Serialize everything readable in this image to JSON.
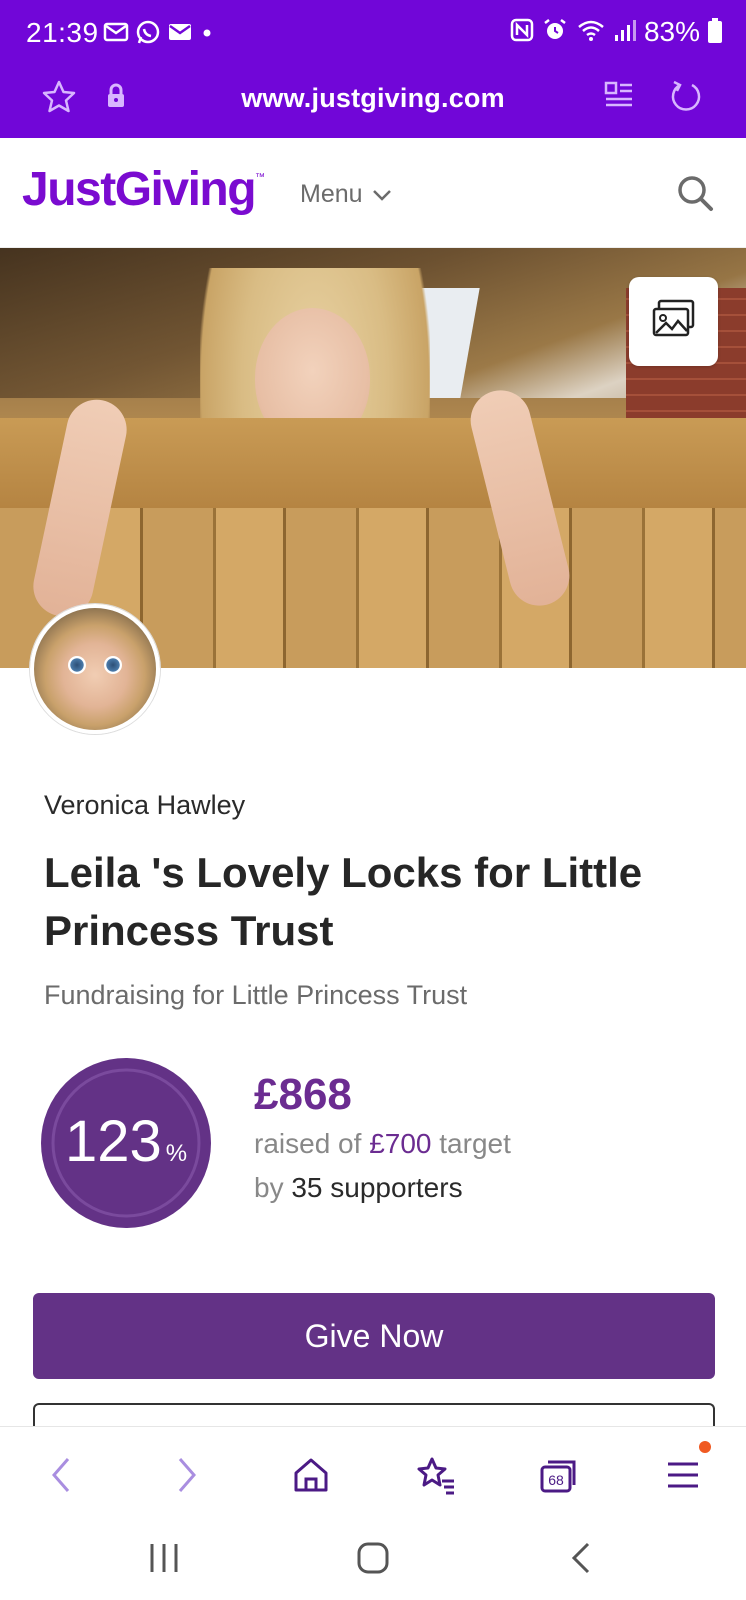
{
  "status_bar": {
    "time": "21:39",
    "battery": "83%"
  },
  "url_bar": {
    "url": "www.justgiving.com"
  },
  "header": {
    "logo": "JustGiving",
    "logo_tm": "™",
    "menu_label": "Menu"
  },
  "fundraiser": {
    "owner": "Veronica Hawley",
    "title": "Leila 's Lovely Locks for Little Princess Trust",
    "subtitle": "Fundraising for Little Princess Trust",
    "progress_percent": "123",
    "progress_symbol": "%",
    "raised": "£868",
    "raised_prefix": "raised of",
    "target": "£700",
    "target_suffix": "target",
    "supporters_prefix": "by",
    "supporters": "35 supporters",
    "give_label": "Give Now"
  },
  "toolbar": {
    "tabs_count": "68"
  },
  "colors": {
    "chrome": "#7106d8",
    "brand": "#7a0bd0",
    "primary": "#633286",
    "accent_text": "#6b2c91",
    "notification": "#f05a22"
  },
  "icons": {
    "status_left": [
      "email-icon",
      "whatsapp-icon",
      "gmail-icon",
      "dot-icon"
    ],
    "status_right": [
      "nfc-icon",
      "alarm-icon",
      "wifi-icon",
      "signal-icon",
      "battery-icon"
    ],
    "url_bar": [
      "bookmark-star-icon",
      "lock-icon",
      "reader-mode-icon",
      "reload-icon"
    ],
    "toolbar": [
      "back-icon",
      "forward-icon",
      "home-icon",
      "bookmarks-icon",
      "tabs-icon",
      "menu-icon"
    ],
    "nav": [
      "recents-icon",
      "home-nav-icon",
      "back-nav-icon"
    ]
  }
}
